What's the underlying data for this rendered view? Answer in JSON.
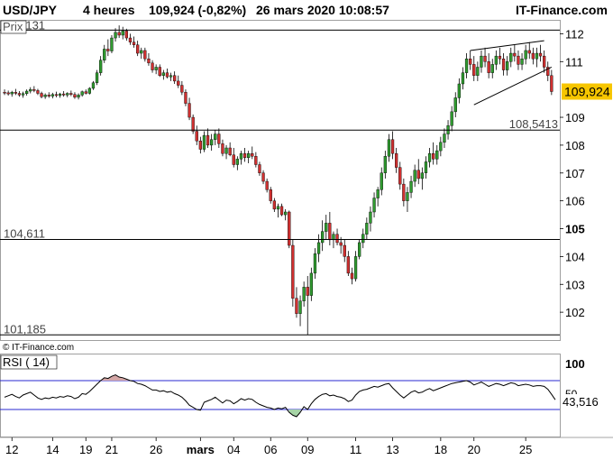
{
  "header": {
    "symbol": "USD/JPY",
    "timeframe": "4 heures",
    "quote": "109,924 (-0,82%)",
    "datetime": "26 mars 2020 10:08:57",
    "brand": "IT-Finance.com"
  },
  "price_panel": {
    "label": "Prix",
    "watermark": "© IT-Finance.com",
    "current_value": "109,924",
    "current_value_num": 109.924,
    "current_bg": "#f7c600",
    "level_labels": [
      {
        "text": "112,131",
        "value": 112.131
      },
      {
        "text": "108,5413",
        "value": 108.5413
      },
      {
        "text": "104,611",
        "value": 104.611
      },
      {
        "text": "101,185",
        "value": 101.185
      }
    ]
  },
  "rsi_panel": {
    "label": "RSI ( 14)",
    "tick_top": "100",
    "tick_mid": "50",
    "current_value": "43,516",
    "current_value_num": 43.516,
    "overbought": 70,
    "oversold": 30
  },
  "colors": {
    "up": "#2f9a2f",
    "down": "#d03030",
    "rsi_band": "#2a2ad0",
    "rsi_over_fill": "#d4a6a6",
    "rsi_under_fill": "#a6d4a6"
  },
  "chart_data": [
    {
      "type": "candlestick",
      "title": "USD/JPY 4 heures",
      "ylim": [
        101.0,
        112.5
      ],
      "y_ticks": [
        {
          "value": 112,
          "label": "112"
        },
        {
          "value": 111,
          "label": "111"
        },
        {
          "value": 109,
          "label": "109"
        },
        {
          "value": 108,
          "label": "108"
        },
        {
          "value": 107,
          "label": "107"
        },
        {
          "value": 106,
          "label": "106"
        },
        {
          "value": 105,
          "label": "105",
          "bold": true
        },
        {
          "value": 104,
          "label": "104"
        },
        {
          "value": 103,
          "label": "103"
        },
        {
          "value": 102,
          "label": "102"
        }
      ],
      "x_ticks": [
        {
          "label": "12",
          "index": 2
        },
        {
          "label": "14",
          "index": 13
        },
        {
          "label": "19",
          "index": 22
        },
        {
          "label": "21",
          "index": 29
        },
        {
          "label": "26",
          "index": 41
        },
        {
          "label": "mars",
          "index": 53,
          "bold": true
        },
        {
          "label": "04",
          "index": 62
        },
        {
          "label": "06",
          "index": 72
        },
        {
          "label": "09",
          "index": 82
        },
        {
          "label": "11",
          "index": 95
        },
        {
          "label": "13",
          "index": 105
        },
        {
          "label": "18",
          "index": 118
        },
        {
          "label": "20",
          "index": 127
        },
        {
          "label": "25",
          "index": 141
        }
      ],
      "x_count": 150,
      "horizontal_levels": [
        112.131,
        108.5413,
        104.611,
        101.185
      ],
      "trend_lines": [
        {
          "from": [
            127,
            109.45
          ],
          "to": [
            148,
            110.8
          ]
        },
        {
          "from": [
            126,
            111.4
          ],
          "to": [
            146,
            111.75
          ]
        }
      ],
      "ohlc": [
        [
          109.9,
          110.0,
          109.8,
          109.88
        ],
        [
          109.88,
          109.96,
          109.78,
          109.84
        ],
        [
          109.84,
          109.95,
          109.74,
          109.9
        ],
        [
          109.9,
          110.02,
          109.8,
          109.86
        ],
        [
          109.86,
          109.94,
          109.74,
          109.8
        ],
        [
          109.8,
          109.92,
          109.7,
          109.85
        ],
        [
          109.85,
          110.0,
          109.78,
          109.94
        ],
        [
          109.94,
          110.08,
          109.86,
          110.0
        ],
        [
          110.0,
          110.12,
          109.9,
          109.96
        ],
        [
          109.96,
          110.02,
          109.8,
          109.86
        ],
        [
          109.86,
          109.92,
          109.68,
          109.74
        ],
        [
          109.74,
          109.86,
          109.66,
          109.8
        ],
        [
          109.8,
          109.9,
          109.7,
          109.76
        ],
        [
          109.76,
          109.88,
          109.68,
          109.82
        ],
        [
          109.82,
          109.92,
          109.72,
          109.78
        ],
        [
          109.78,
          109.88,
          109.7,
          109.84
        ],
        [
          109.84,
          109.94,
          109.74,
          109.8
        ],
        [
          109.8,
          109.9,
          109.72,
          109.86
        ],
        [
          109.86,
          109.96,
          109.76,
          109.82
        ],
        [
          109.82,
          109.9,
          109.66,
          109.72
        ],
        [
          109.72,
          109.86,
          109.64,
          109.8
        ],
        [
          109.8,
          109.96,
          109.74,
          109.92
        ],
        [
          109.92,
          110.0,
          109.82,
          109.86
        ],
        [
          109.86,
          110.08,
          109.82,
          110.04
        ],
        [
          110.04,
          110.3,
          109.98,
          110.24
        ],
        [
          110.24,
          110.7,
          110.16,
          110.6
        ],
        [
          110.6,
          111.2,
          110.5,
          111.05
        ],
        [
          111.05,
          111.6,
          110.95,
          111.45
        ],
        [
          111.45,
          111.8,
          111.2,
          111.38
        ],
        [
          111.38,
          111.95,
          111.3,
          111.85
        ],
        [
          111.85,
          112.2,
          111.72,
          112.05
        ],
        [
          112.05,
          112.3,
          111.85,
          111.95
        ],
        [
          111.95,
          112.25,
          111.8,
          112.1
        ],
        [
          112.1,
          112.18,
          111.75,
          111.85
        ],
        [
          111.85,
          112.0,
          111.6,
          111.7
        ],
        [
          111.7,
          111.9,
          111.5,
          111.6
        ],
        [
          111.6,
          111.75,
          111.2,
          111.3
        ],
        [
          111.3,
          111.5,
          111.1,
          111.4
        ],
        [
          111.4,
          111.5,
          111.0,
          111.1
        ],
        [
          111.1,
          111.3,
          110.85,
          110.95
        ],
        [
          110.95,
          111.05,
          110.6,
          110.7
        ],
        [
          110.7,
          110.9,
          110.55,
          110.8
        ],
        [
          110.8,
          110.9,
          110.45,
          110.5
        ],
        [
          110.5,
          110.7,
          110.35,
          110.6
        ],
        [
          110.6,
          110.75,
          110.4,
          110.45
        ],
        [
          110.45,
          110.6,
          110.3,
          110.5
        ],
        [
          110.5,
          110.65,
          110.2,
          110.3
        ],
        [
          110.3,
          110.5,
          110.05,
          110.15
        ],
        [
          110.15,
          110.3,
          109.8,
          109.9
        ],
        [
          109.9,
          110.0,
          109.4,
          109.5
        ],
        [
          109.5,
          109.7,
          108.9,
          109.0
        ],
        [
          109.0,
          109.1,
          108.4,
          108.5
        ],
        [
          108.5,
          108.7,
          108.0,
          108.15
        ],
        [
          108.15,
          108.3,
          107.7,
          107.85
        ],
        [
          107.85,
          108.5,
          107.75,
          108.35
        ],
        [
          108.35,
          108.6,
          107.9,
          108.0
        ],
        [
          108.0,
          108.4,
          107.8,
          108.2
        ],
        [
          108.2,
          108.55,
          108.0,
          108.4
        ],
        [
          108.4,
          108.6,
          107.9,
          108.05
        ],
        [
          108.05,
          108.2,
          107.6,
          107.7
        ],
        [
          107.7,
          108.0,
          107.5,
          107.9
        ],
        [
          107.9,
          108.1,
          107.6,
          107.65
        ],
        [
          107.65,
          107.9,
          107.2,
          107.3
        ],
        [
          107.3,
          107.6,
          107.1,
          107.5
        ],
        [
          107.5,
          107.8,
          107.3,
          107.7
        ],
        [
          107.7,
          107.9,
          107.4,
          107.55
        ],
        [
          107.55,
          107.8,
          107.35,
          107.7
        ],
        [
          107.7,
          107.95,
          107.5,
          107.6
        ],
        [
          107.6,
          107.75,
          107.2,
          107.3
        ],
        [
          107.3,
          107.4,
          106.9,
          107.0
        ],
        [
          107.0,
          107.1,
          106.6,
          106.7
        ],
        [
          106.7,
          106.8,
          106.3,
          106.4
        ],
        [
          106.4,
          106.5,
          105.9,
          106.0
        ],
        [
          106.0,
          106.1,
          105.6,
          105.7
        ],
        [
          105.7,
          105.9,
          105.4,
          105.8
        ],
        [
          105.8,
          105.9,
          105.45,
          105.5
        ],
        [
          105.5,
          105.7,
          105.3,
          105.6
        ],
        [
          105.6,
          105.65,
          104.3,
          104.4
        ],
        [
          104.4,
          104.6,
          102.2,
          102.5
        ],
        [
          102.5,
          102.9,
          101.8,
          101.95
        ],
        [
          101.95,
          102.6,
          101.5,
          102.4
        ],
        [
          102.4,
          103.1,
          102.2,
          102.9
        ],
        [
          102.9,
          103.3,
          101.185,
          102.6
        ],
        [
          102.6,
          103.6,
          102.4,
          103.4
        ],
        [
          103.4,
          104.3,
          103.2,
          104.1
        ],
        [
          104.1,
          104.8,
          103.8,
          104.5
        ],
        [
          104.5,
          105.3,
          104.2,
          104.9
        ],
        [
          104.9,
          105.5,
          104.6,
          105.2
        ],
        [
          105.2,
          105.6,
          104.4,
          104.6
        ],
        [
          104.6,
          104.9,
          104.3,
          104.8
        ],
        [
          104.8,
          105.0,
          104.4,
          104.5
        ],
        [
          104.5,
          104.7,
          104.1,
          104.4
        ],
        [
          104.4,
          104.6,
          103.8,
          104.0
        ],
        [
          104.0,
          104.2,
          103.3,
          103.4
        ],
        [
          103.4,
          103.6,
          103.0,
          103.2
        ],
        [
          103.2,
          104.2,
          103.1,
          104.0
        ],
        [
          104.0,
          104.6,
          103.9,
          104.5
        ],
        [
          104.5,
          105.0,
          104.3,
          104.8
        ],
        [
          104.8,
          105.4,
          104.6,
          105.2
        ],
        [
          105.2,
          105.8,
          104.9,
          105.6
        ],
        [
          105.6,
          106.3,
          105.4,
          106.1
        ],
        [
          106.1,
          106.5,
          105.8,
          106.4
        ],
        [
          106.4,
          107.2,
          106.2,
          107.0
        ],
        [
          107.0,
          107.8,
          106.8,
          107.6
        ],
        [
          107.6,
          108.4,
          107.4,
          108.2
        ],
        [
          108.2,
          108.5,
          107.5,
          107.7
        ],
        [
          107.7,
          107.9,
          107.0,
          107.2
        ],
        [
          107.2,
          107.4,
          106.4,
          106.6
        ],
        [
          106.6,
          106.8,
          105.8,
          106.0
        ],
        [
          106.0,
          106.5,
          105.6,
          106.3
        ],
        [
          106.3,
          106.9,
          106.1,
          106.7
        ],
        [
          106.7,
          107.3,
          106.5,
          107.1
        ],
        [
          107.1,
          107.5,
          106.6,
          106.8
        ],
        [
          106.8,
          107.2,
          106.4,
          107.0
        ],
        [
          107.0,
          107.6,
          106.8,
          107.4
        ],
        [
          107.4,
          107.9,
          107.2,
          107.7
        ],
        [
          107.7,
          108.1,
          107.3,
          107.5
        ],
        [
          107.5,
          108.0,
          107.3,
          107.8
        ],
        [
          107.8,
          108.3,
          107.6,
          108.1
        ],
        [
          108.1,
          108.6,
          107.9,
          108.4
        ],
        [
          108.4,
          108.9,
          108.2,
          108.7
        ],
        [
          108.7,
          109.4,
          108.5,
          109.2
        ],
        [
          109.2,
          109.9,
          109.0,
          109.7
        ],
        [
          109.7,
          110.4,
          109.5,
          110.2
        ],
        [
          110.2,
          110.8,
          110.0,
          110.6
        ],
        [
          110.6,
          111.3,
          110.4,
          111.1
        ],
        [
          111.1,
          111.4,
          110.7,
          110.9
        ],
        [
          110.9,
          111.2,
          110.3,
          110.5
        ],
        [
          110.5,
          111.0,
          110.3,
          110.8
        ],
        [
          110.8,
          111.4,
          110.6,
          111.2
        ],
        [
          111.2,
          111.5,
          110.8,
          111.0
        ],
        [
          111.0,
          111.3,
          110.4,
          110.6
        ],
        [
          110.6,
          111.1,
          110.4,
          110.9
        ],
        [
          110.9,
          111.4,
          110.7,
          111.2
        ],
        [
          111.2,
          111.5,
          110.9,
          111.1
        ],
        [
          111.1,
          111.3,
          110.5,
          110.7
        ],
        [
          110.7,
          111.2,
          110.5,
          111.0
        ],
        [
          111.0,
          111.5,
          110.8,
          111.3
        ],
        [
          111.3,
          111.6,
          111.0,
          111.2
        ],
        [
          111.2,
          111.4,
          110.7,
          110.9
        ],
        [
          110.9,
          111.3,
          110.7,
          111.1
        ],
        [
          111.1,
          111.6,
          110.9,
          111.4
        ],
        [
          111.4,
          111.7,
          111.1,
          111.3
        ],
        [
          111.3,
          111.5,
          110.9,
          111.1
        ],
        [
          111.1,
          111.5,
          110.8,
          111.3
        ],
        [
          111.3,
          111.6,
          111.0,
          111.2
        ],
        [
          111.2,
          111.4,
          110.6,
          110.8
        ],
        [
          110.8,
          111.0,
          110.3,
          110.5
        ],
        [
          110.5,
          110.7,
          109.8,
          109.924
        ]
      ]
    },
    {
      "type": "line",
      "title": "RSI ( 14)",
      "ylim": [
        0,
        100
      ],
      "band_levels": [
        70,
        30
      ],
      "values": [
        47,
        49,
        51,
        48,
        46,
        50,
        52,
        54,
        50,
        46,
        44,
        46,
        45,
        47,
        46,
        48,
        47,
        49,
        48,
        45,
        47,
        52,
        51,
        55,
        60,
        65,
        70,
        74,
        73,
        76,
        78,
        75,
        74,
        72,
        70,
        69,
        66,
        65,
        63,
        60,
        57,
        57,
        55,
        56,
        54,
        55,
        52,
        50,
        47,
        42,
        36,
        33,
        30,
        29,
        40,
        42,
        44,
        47,
        43,
        39,
        43,
        42,
        38,
        41,
        45,
        43,
        45,
        44,
        40,
        37,
        35,
        33,
        32,
        30,
        32,
        31,
        33,
        26,
        22,
        20,
        26,
        34,
        30,
        38,
        44,
        48,
        51,
        52,
        49,
        50,
        48,
        47,
        45,
        41,
        43,
        50,
        55,
        57,
        58,
        60,
        62,
        61,
        63,
        65,
        66,
        60,
        55,
        50,
        46,
        50,
        54,
        56,
        53,
        54,
        57,
        59,
        56,
        58,
        60,
        62,
        64,
        66,
        67,
        68,
        69,
        70,
        68,
        64,
        66,
        68,
        65,
        62,
        64,
        66,
        65,
        63,
        65,
        67,
        66,
        63,
        64,
        65,
        64,
        62,
        63,
        63,
        62,
        58,
        51,
        43.516
      ]
    }
  ]
}
